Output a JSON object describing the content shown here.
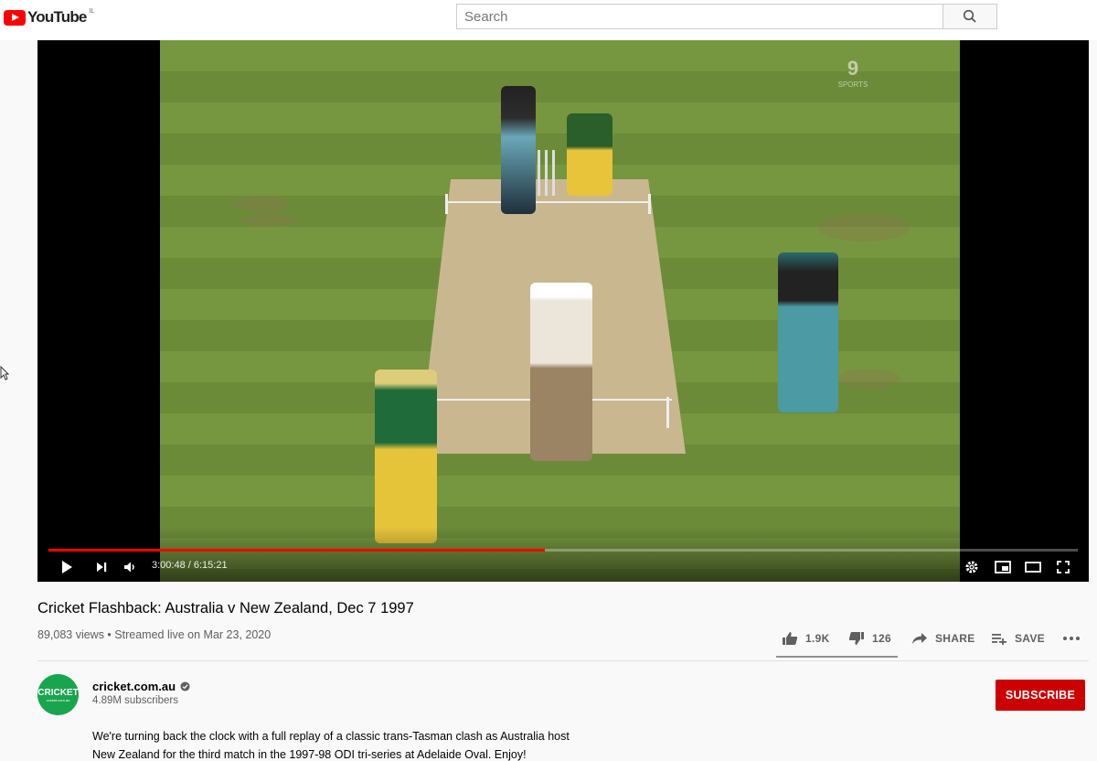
{
  "header": {
    "logo_text": "YouTube",
    "logo_country": "IL",
    "search_placeholder": "Search"
  },
  "player": {
    "broadcaster_logo": "9",
    "broadcaster_sub": "SPORTS",
    "time_current": "3:00:48",
    "time_total": "6:15:21",
    "time_display": "3:00:48 / 6:15:21",
    "progress_fraction": 0.482
  },
  "video": {
    "title": "Cricket Flashback: Australia v New Zealand, Dec 7 1997",
    "meta": "89,083 views • Streamed live on Mar 23, 2020",
    "like_count": "1.9K",
    "dislike_count": "126",
    "share_label": "SHARE",
    "save_label": "SAVE",
    "like_fraction": 0.938
  },
  "channel": {
    "name": "cricket.com.au",
    "subscribers": "4.89M subscribers",
    "avatar_text": "CRICKET",
    "avatar_sub": "cricket.com.au",
    "subscribe_label": "SUBSCRIBE"
  },
  "description": {
    "line1": "We're turning back the clock with a full replay of a classic trans-Tasman clash as Australia host",
    "line2": "New Zealand for the third match in the 1997-98 ODI tri-series at Adelaide Oval. Enjoy!"
  },
  "colors": {
    "brand_red": "#ff0000",
    "subscribe_red": "#cc0000",
    "progress_red": "#ff0000",
    "avatar_green": "#19a54d"
  }
}
